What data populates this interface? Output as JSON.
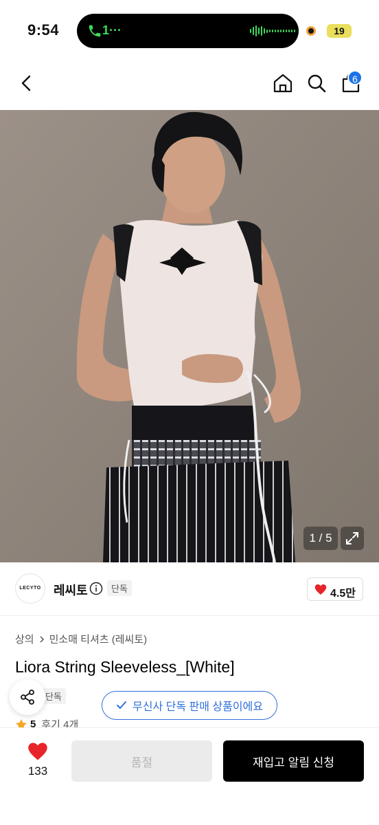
{
  "status_bar": {
    "time": "9:54",
    "call_label": "1···",
    "battery": "19"
  },
  "nav": {
    "cart_count": "6"
  },
  "gallery": {
    "counter": "1 / 5"
  },
  "brand": {
    "logo_text": "LECYTO",
    "name": "레씨토",
    "tag": "단독",
    "likes": "4.5만"
  },
  "product": {
    "breadcrumb": [
      "상의",
      "민소매 티셔츠 (레씨토)"
    ],
    "title": "Liora String Sleeveless_[White]",
    "tag": "단독",
    "exclusive_notice": "무신사 단독 판매 상품이에요",
    "rating": "5",
    "reviews": "후기 4개"
  },
  "bottom": {
    "wish_count": "133",
    "soldout_label": "품절",
    "restock_label": "재입고 알림 신청"
  },
  "colors": {
    "accent_blue": "#2f6fdb",
    "heart_red": "#e8242b",
    "badge_blue": "#1a72e8"
  }
}
